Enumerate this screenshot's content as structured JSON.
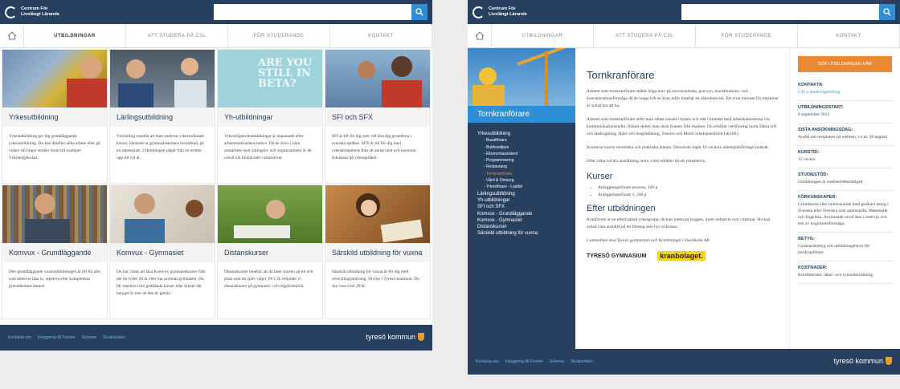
{
  "header": {
    "logo_line1": "Centrum För",
    "logo_line2": "Livslångt Lärande"
  },
  "nav": {
    "items": [
      "UTBILDNINGAR",
      "ATT STUDERA PÅ C3L",
      "FÖR STUDERANDE",
      "KONTAKT"
    ]
  },
  "left": {
    "tiles": [
      {
        "title": "Yrkesutbildning",
        "desc": "Yrkesutbildning ger dig grundläggande yrkesutbildning. Du kan därefter söka arbete eller gå vidare till högre studier inom till exempel Yrkeshögskolan.",
        "photo": "worker-machine"
      },
      {
        "title": "Lärlingsutbildning",
        "desc": "Vuxlärling innebär att man studerar yrkesinriktade kurser, härstade ur gymnasieskolans kursutbud, på en arbetsplats. Utbildningen pågår från en termin upp till två år.",
        "photo": "apprentice"
      },
      {
        "title": "Yh-utbildningar",
        "desc": "Yrkeshögskoleutbildningar är anpassade efter arbetsmarknadens behov. Då de drivs i nära samarbete med näringsliv och organisationer är de också väl förankrade i arbetslivet.",
        "photo": "beta-banner"
      },
      {
        "title": "SFI och SFX",
        "desc": "SFI är till för dig som vill lära dig grunderna i svenska språket. SFX är till för dig med yrkeskompetens från ett annat land och kurserna fokuserar på yrkesspråket.",
        "photo": "students"
      },
      {
        "title": "Komvux - Grundläggande",
        "desc": "Den grundläggande vuxenutbildningen är till för alla som behöver läsa in, repetera eller komplettera grundskolans ämnen.",
        "photo": "library"
      },
      {
        "title": "Komvux - Gymnasiet",
        "desc": "Du har chans att läsa Komvux gymnasiekurser från det du fyller 20 år eller har avslutat gymnasiet. Du får repetera icke godkända kurser eller kurser där betyget är mer än åtta år gamla.",
        "photo": "study-pair"
      },
      {
        "title": "Distanskurser",
        "desc": "Distanskurser innebär att du läser kursen på tid och plats som du själv väljer. På C3L erbjuder vi distanskurser på gymnasie- och högskolenivå.",
        "photo": "grass-reader"
      },
      {
        "title": "Särskild utbildning för vuxna",
        "desc": "Särskild utbildning för vuxna är för dig med utvecklingsstörning. Du bor i Tyresö kommun. Du ska vara över 20 år.",
        "photo": "girl-book"
      }
    ]
  },
  "footer": {
    "links": [
      "Kontakta oss",
      "Inloggning till Fronter",
      "Schema",
      "Skolportalen"
    ],
    "brand": "tyresö kommun"
  },
  "right": {
    "section_heading": "Tornkranförare",
    "menu": [
      {
        "label": "Yrkesutbildning",
        "level": 0
      },
      {
        "label": "- Busstförare",
        "level": 1
      },
      {
        "label": "- Butikssäljare",
        "level": 1
      },
      {
        "label": "- Ekonomiassistent",
        "level": 1
      },
      {
        "label": "- Programmering",
        "level": 1
      },
      {
        "label": "- Restaurang",
        "level": 1
      },
      {
        "label": "- Tornkranförare",
        "level": 1,
        "current": true
      },
      {
        "label": "- Vård & Omsorg",
        "level": 1
      },
      {
        "label": "- Yrkesförare - Lastbil",
        "level": 1
      },
      {
        "label": "Lärlingsutbildning",
        "level": 0
      },
      {
        "label": "Yh-utbildningar",
        "level": 0
      },
      {
        "label": "SFI och SFX",
        "level": 0
      },
      {
        "label": "Komvux - Grundläggande",
        "level": 0
      },
      {
        "label": "Komvux - Gymnasiet",
        "level": 0
      },
      {
        "label": "Distanskurser",
        "level": 0
      },
      {
        "label": "Särskild utbildning för vuxna",
        "level": 0
      }
    ],
    "title": "Tornkranförare",
    "p1": "Arbetet som tornkranförare ställer höga krav på ansvarskänsla, god syn, koordinations- och koncentrationsförmåga då de tunga lyft en kran utför innebär en säkerhetsrisk. Ett visst intresse för maskiner är också bra att ha.",
    "p2": "Arbetet som tornkranförare utför man oftast ensam i hytten och står i kontakt med arbetskamraterna via kommunikationsradio. Ibland sköter man dock kranen från marken. Du erhåller certifiering inom Säkra lyft och lastkoppling, Hjärt och lungräddning, Travers och Mobil arbetsplatsform (skylift).",
    "p3": "Kurserna varvar teoretiska och praktiska ämnen. Dessutom ingår 10 veckors arbetsplatsförlagd praktik.",
    "p4": "Efter cirka två års anställning inom yrket erhåller du ett yrkesbevis.",
    "kurser_heading": "Kurser",
    "kurser": [
      "Anläggningsförare process, 100 p",
      "Anläggningsförare 1, 200 p"
    ],
    "efter_heading": "Efter utbildningen",
    "p5": "Kranförare är en efterfraktad yrkesgrupp, du kan jobba på byggen, inom industrin och i hamnar. Du kan också vara anställd på ett företag som hyr ut kranar.",
    "p6": "I samarbete med Tyresö gymnasium och Kranbolaget i Stockholm AB",
    "logo1": "TYRESÖ GYMNASIUM",
    "logo2": "kranbolaget.",
    "cta": "SÖK UTBILDNINGEN HÄR",
    "info": [
      {
        "label": "KONTAKTA:",
        "value": "C3L:s studievägledning",
        "link": true
      },
      {
        "label": "UTBILDNINGSSTART:",
        "value": "8 september 2014"
      },
      {
        "label": "SISTA ANSÖKNINGSDAG:",
        "value": "Ansök om restplatser på webben, t.o.m. 20 augusti"
      },
      {
        "label": "KURSTID:",
        "value": "15 veckor"
      },
      {
        "label": "STUDIESTÖD:",
        "value": "Utbildningen är studiestödberättigad"
      },
      {
        "label": "FÖRKUNSKAPER:",
        "value": "Grundskola eller motsvarande med godkänt betyg i Svenska eller Svenska som andraspråk, Matematik och Engelska. Avslutande urval sker i intervju och test av kognitionsförmåga."
      },
      {
        "label": "BETYG:",
        "value": "Gymnasiebetyg och utbildningsbevis för tornkranförare"
      },
      {
        "label": "KOSTNADER:",
        "value": "Kurslitteratur, läkar- och synundersökning"
      }
    ]
  },
  "colors": {
    "navy": "#27405f",
    "blue": "#2f8fd6",
    "orange": "#e98932"
  }
}
